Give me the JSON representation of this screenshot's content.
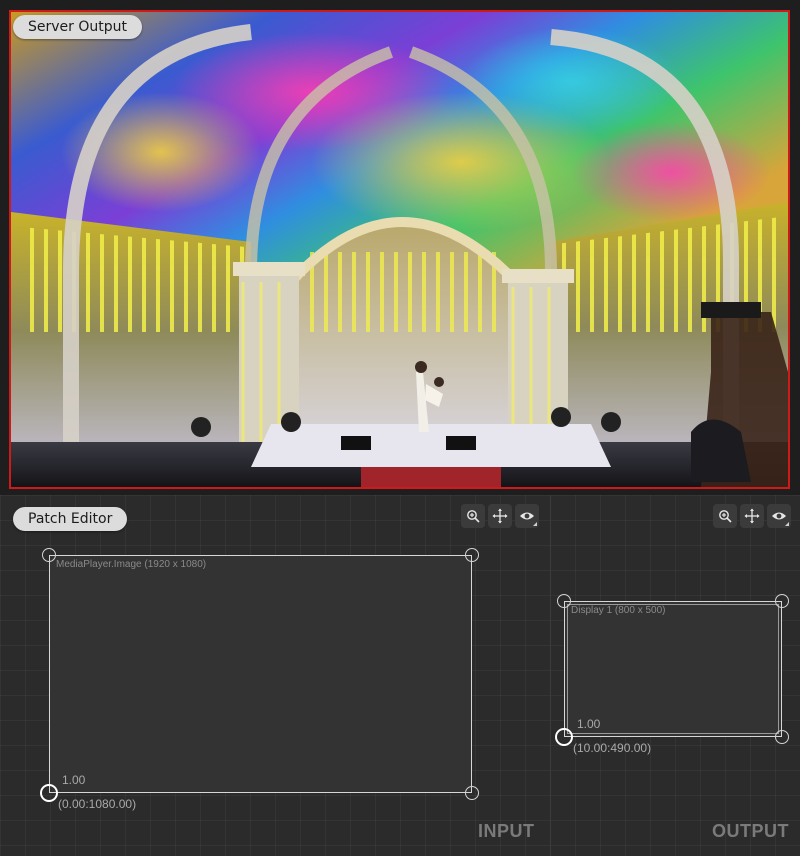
{
  "server_output": {
    "label": "Server Output",
    "frame_color": "#d01a1a",
    "image": "projection-mapping-stage-photo"
  },
  "patch_editor": {
    "label": "Patch Editor",
    "input": {
      "surface_title": "MediaPlayer.Image (1920 x 1080)",
      "scale": "1.00",
      "origin": "(0.00:1080.00)",
      "section_label": "INPUT",
      "tools": [
        "zoom-icon",
        "move-icon",
        "eye-icon"
      ]
    },
    "output": {
      "surface_title": "Display 1 (800 x 500)",
      "scale": "1.00",
      "origin": "(10.00:490.00)",
      "section_label": "OUTPUT",
      "tools": [
        "zoom-icon",
        "move-icon",
        "eye-icon"
      ]
    }
  }
}
